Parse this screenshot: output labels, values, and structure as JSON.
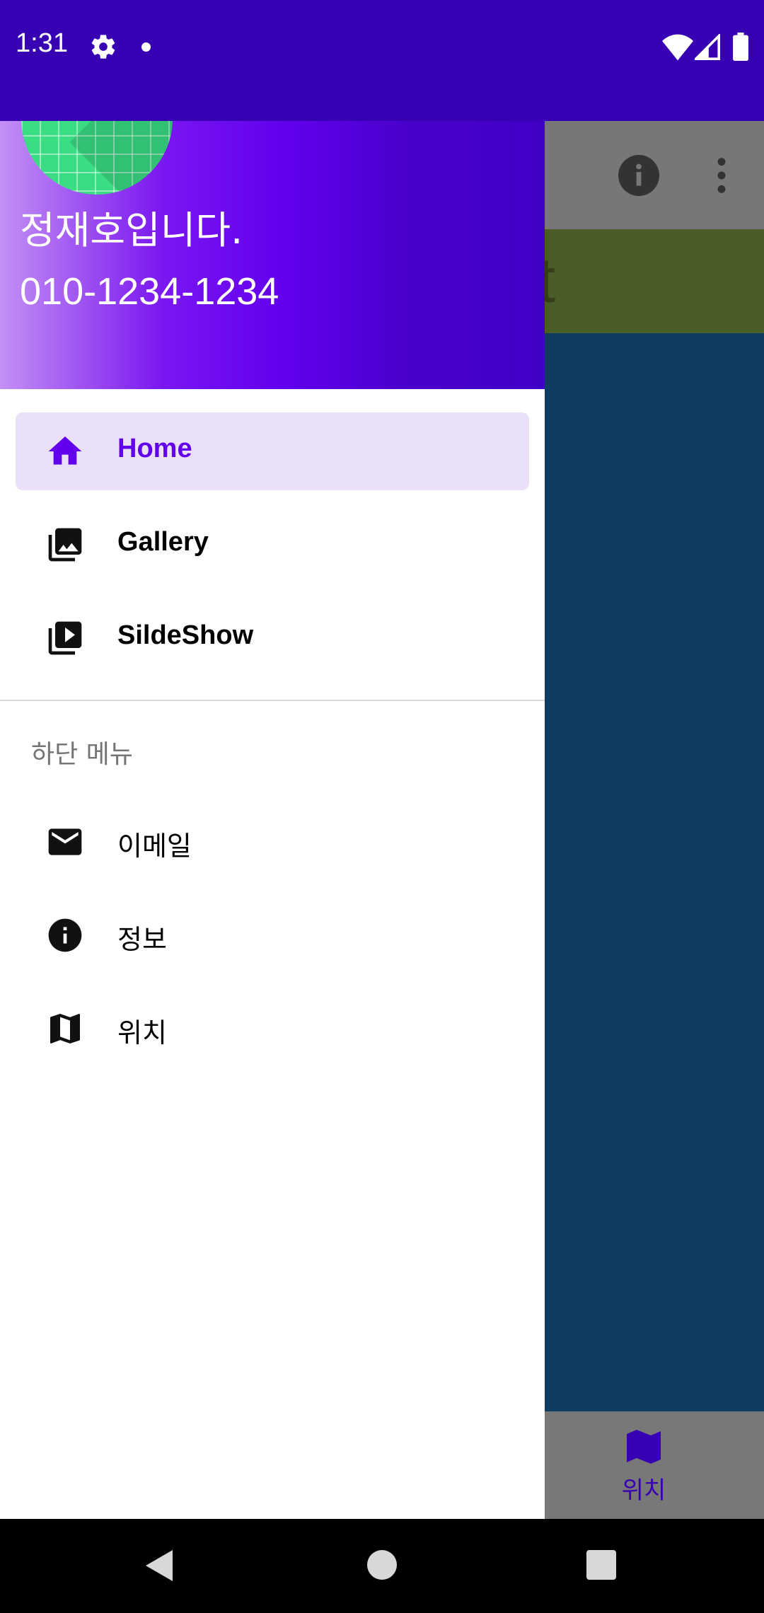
{
  "status_bar": {
    "time": "1:31",
    "icons": [
      "gear-icon",
      "notification-dot",
      "wifi-icon",
      "signal-icon",
      "battery-icon"
    ],
    "background": "#3700B3"
  },
  "background_app": {
    "toolbar_icons": [
      "info-icon",
      "more-vert-icon"
    ],
    "banner_text_fragment": "t",
    "fab_icon": "mail-icon",
    "bottom_nav": {
      "label": "위치",
      "icon": "map-icon"
    },
    "colors": {
      "toolbar": "#777777",
      "banner": "#4A5C28",
      "content": "#0F3C61",
      "fab": "#075849"
    }
  },
  "drawer": {
    "header": {
      "name": "정재호입니다.",
      "phone": "010-1234-1234",
      "gradient_colors": [
        "#C390F4",
        "#6200EE",
        "#3F00C6"
      ]
    },
    "primary_items": [
      {
        "label": "Home",
        "icon": "home-icon",
        "active": true
      },
      {
        "label": "Gallery",
        "icon": "photo-library-icon",
        "active": false
      },
      {
        "label": "SildeShow",
        "icon": "slideshow-icon",
        "active": false
      }
    ],
    "section_title": "하단 메뉴",
    "secondary_items": [
      {
        "label": "이메일",
        "icon": "mail-icon"
      },
      {
        "label": "정보",
        "icon": "info-icon"
      },
      {
        "label": "위치",
        "icon": "map-icon"
      }
    ],
    "accent_color": "#6200EE",
    "active_item_bg": "#EAE0F8"
  },
  "nav_bar": {
    "buttons": [
      "back",
      "home",
      "recents"
    ]
  }
}
